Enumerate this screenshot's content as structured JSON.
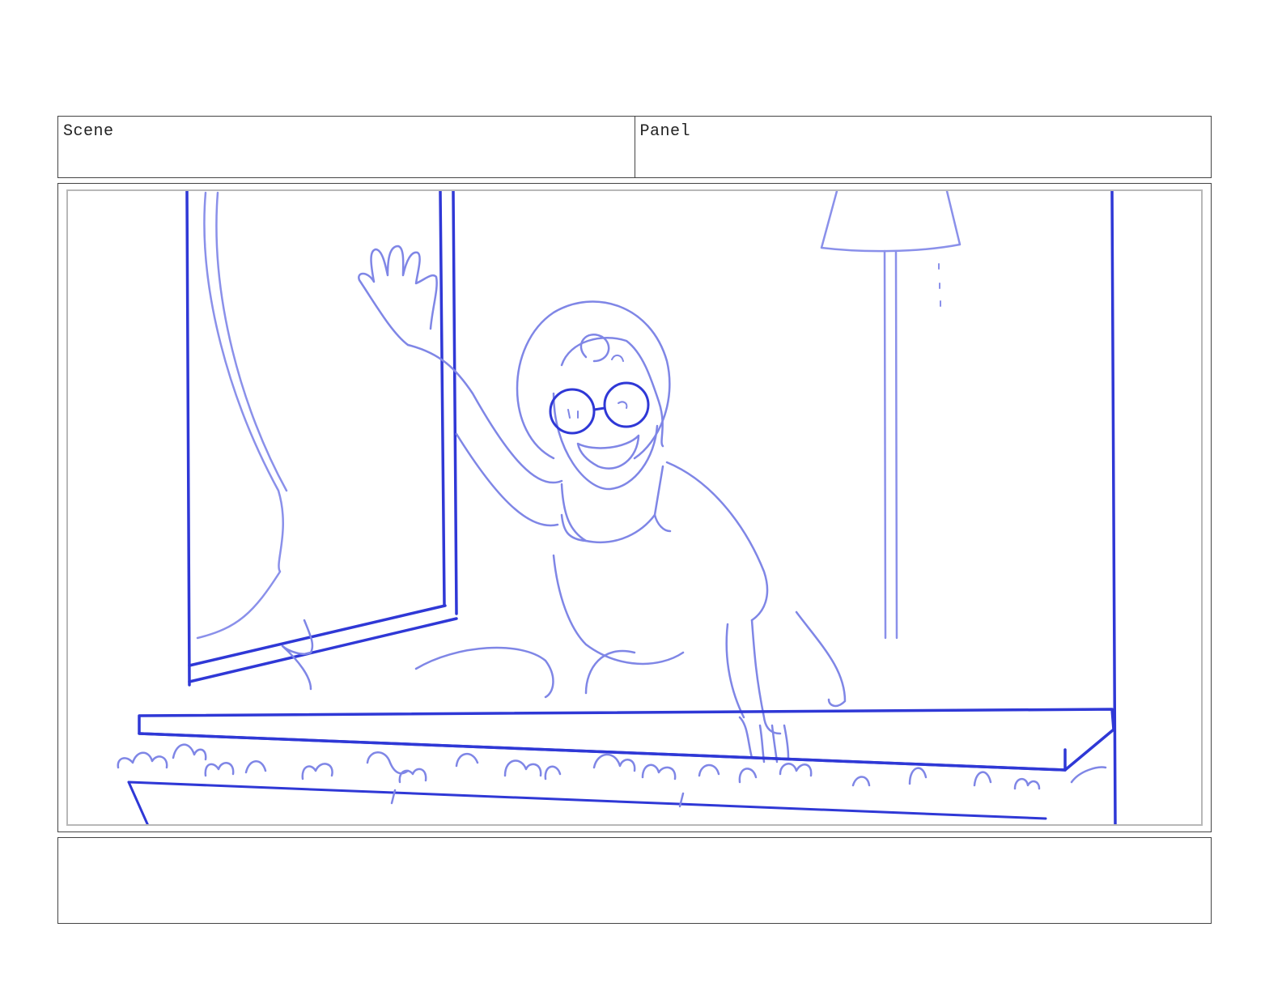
{
  "header": {
    "scene_label": "Scene",
    "panel_label": "Panel"
  },
  "colors": {
    "ink_dark": "#2f38d6",
    "ink_light": "#7f86e6"
  },
  "notes": {
    "text": ""
  }
}
